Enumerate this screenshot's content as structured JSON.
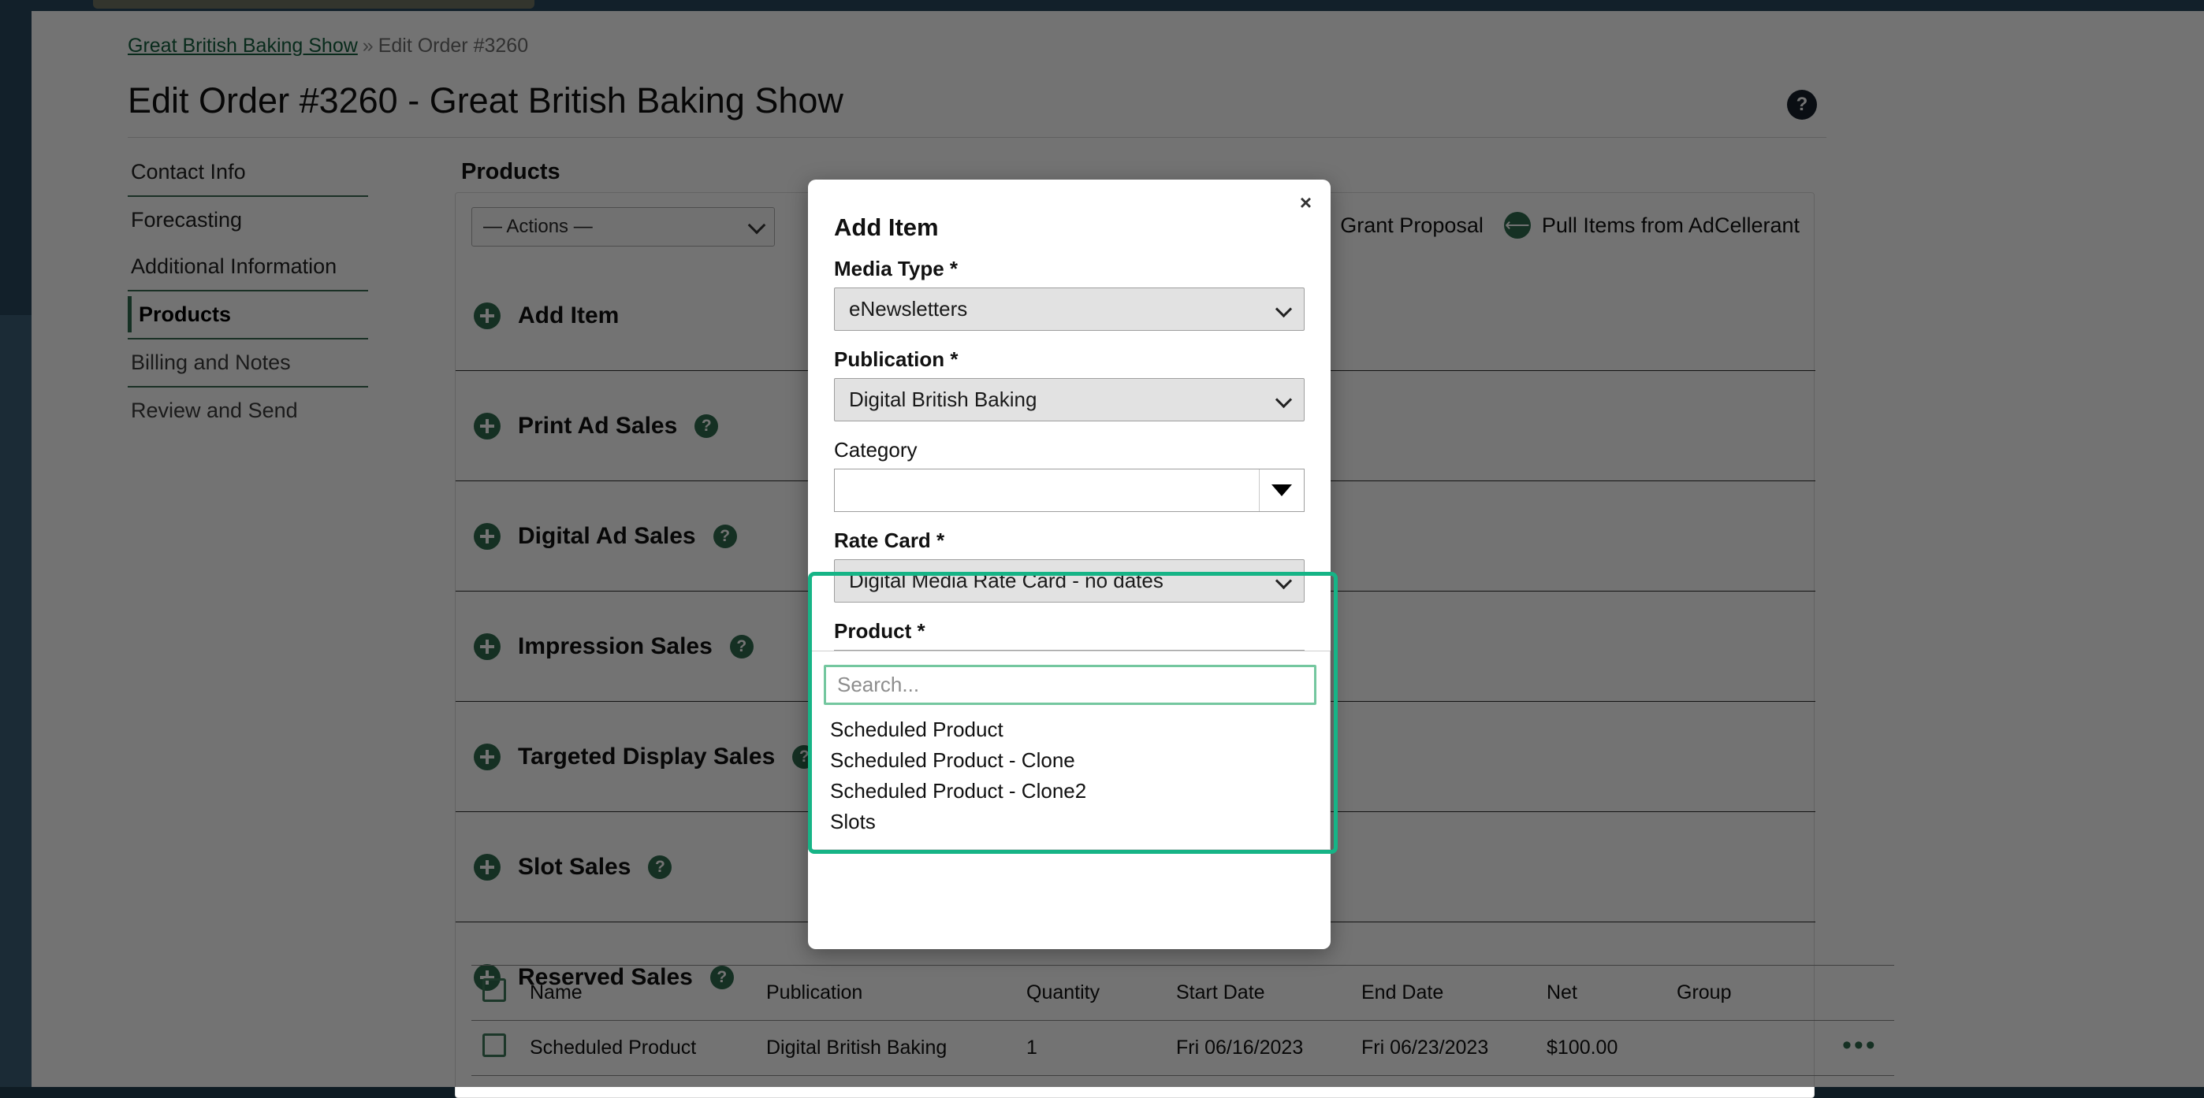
{
  "breadcrumb": {
    "link": "Great British Baking Show",
    "separator": "»",
    "current": "Edit Order #3260"
  },
  "header": {
    "title": "Edit Order #3260 - Great British Baking Show",
    "help_icon": "question-mark-icon"
  },
  "sidebar": {
    "items": [
      {
        "label": "Contact Info",
        "state": "default"
      },
      {
        "label": "Forecasting",
        "state": "default"
      },
      {
        "label": "Additional Information",
        "state": "default"
      },
      {
        "label": "Products",
        "state": "active"
      },
      {
        "label": "Billing and Notes",
        "state": "muted"
      },
      {
        "label": "Review and Send",
        "state": "muted"
      }
    ]
  },
  "products_panel": {
    "heading": "Products",
    "actions_select": "— Actions —",
    "top_links": [
      {
        "label": "Grant Proposal",
        "icon": ""
      },
      {
        "label": "Pull Items from AdCellerant",
        "icon": "arrow-left-circle-icon"
      }
    ],
    "accordion": [
      {
        "label": "Add Item",
        "icon": "plus-circle-icon",
        "help": false
      },
      {
        "label": "Print Ad Sales",
        "icon": "plus-circle-icon",
        "help": true
      },
      {
        "label": "Digital Ad Sales",
        "icon": "plus-circle-icon",
        "help": true
      },
      {
        "label": "Impression Sales",
        "icon": "plus-circle-icon",
        "help": true
      },
      {
        "label": "Targeted Display Sales",
        "icon": "plus-circle-icon",
        "help": true
      },
      {
        "label": "Slot Sales",
        "icon": "plus-circle-icon",
        "help": true
      },
      {
        "label": "Reserved Sales",
        "icon": "plus-circle-icon",
        "help": true
      }
    ],
    "table": {
      "columns": [
        "Name",
        "Publication",
        "Quantity",
        "Start Date",
        "End Date",
        "Net",
        "Group"
      ],
      "rows": [
        {
          "name": "Scheduled Product",
          "publication": "Digital British Baking",
          "quantity": "1",
          "start_date": "Fri 06/16/2023",
          "end_date": "Fri 06/23/2023",
          "net": "$100.00",
          "group": "",
          "actions": "•••"
        }
      ]
    }
  },
  "modal": {
    "title": "Add Item",
    "close_label": "×",
    "fields": {
      "media_type": {
        "label": "Media Type *",
        "value": "eNewsletters"
      },
      "publication": {
        "label": "Publication *",
        "value": "Digital British Baking"
      },
      "category": {
        "label": "Category",
        "value": ""
      },
      "rate_card": {
        "label": "Rate Card *",
        "value": "Digital Media Rate Card - no dates"
      },
      "product": {
        "label": "Product *",
        "value": ""
      }
    },
    "dropdown": {
      "search_placeholder": "Search...",
      "search_value": "",
      "options": [
        "Scheduled Product",
        "Scheduled Product - Clone",
        "Scheduled Product - Clone2",
        "Slots"
      ]
    }
  },
  "colors": {
    "brand_green": "#2f6b4f",
    "focus_green": "#16b486",
    "link_green": "#14613f"
  }
}
